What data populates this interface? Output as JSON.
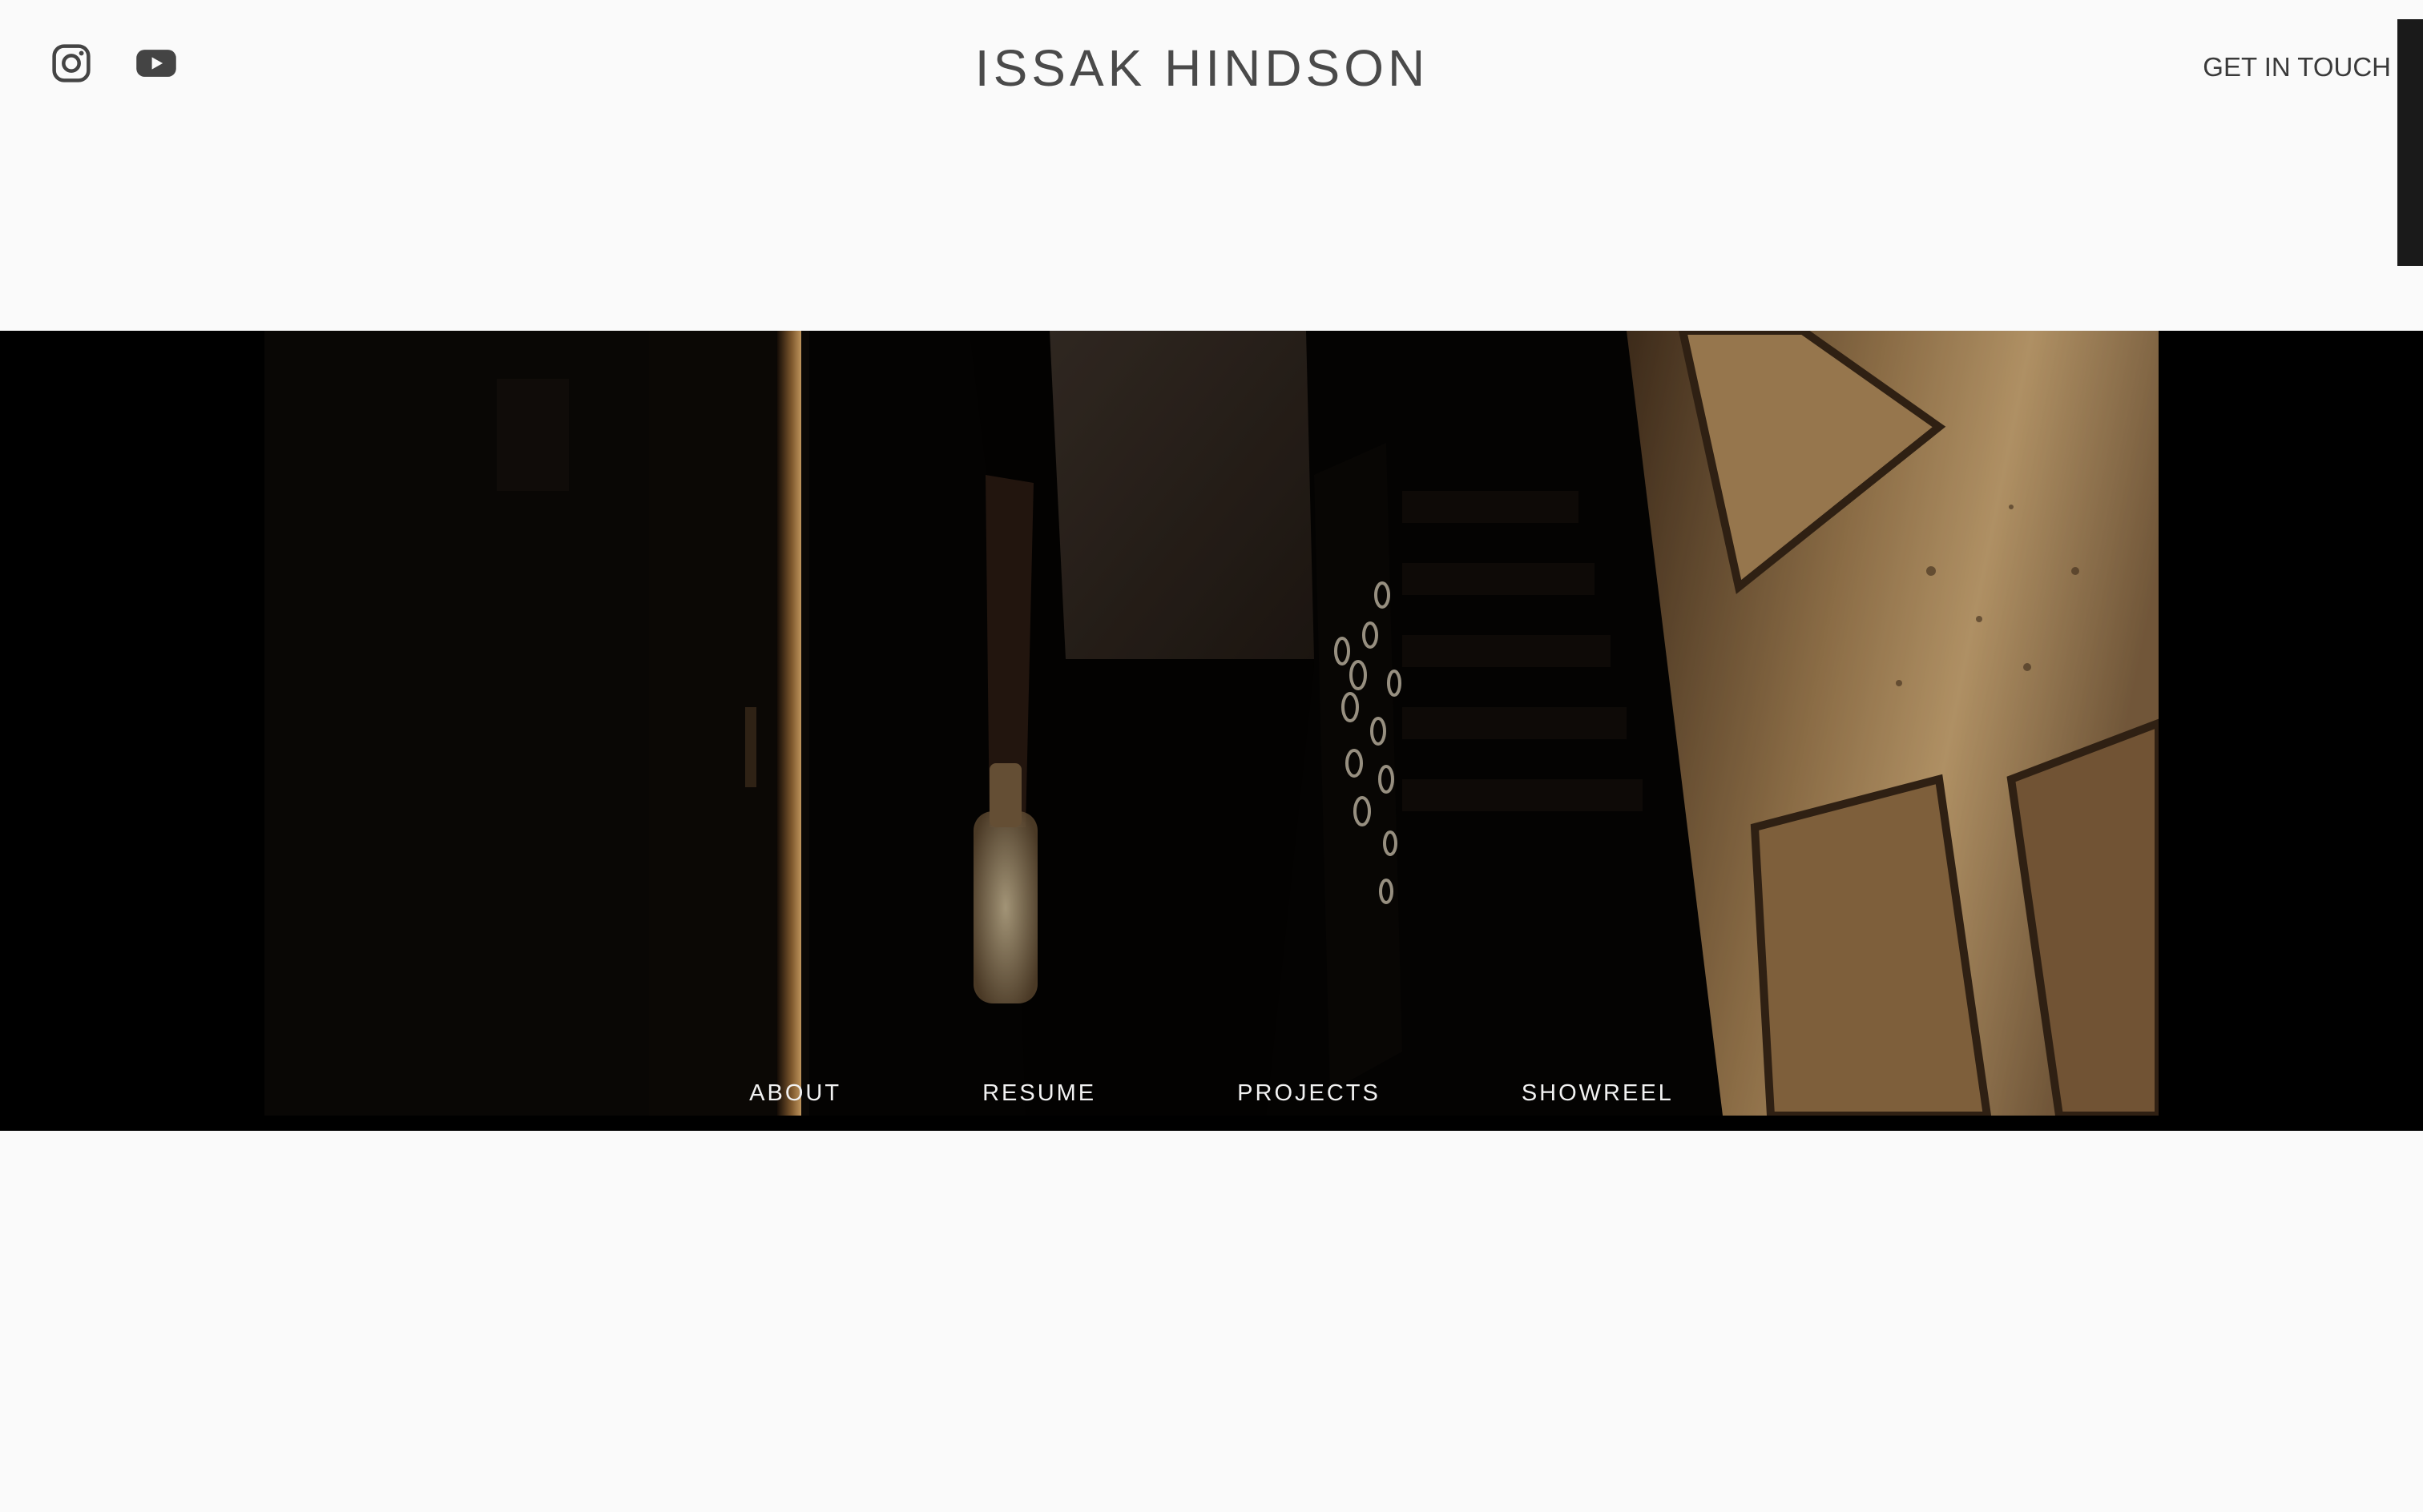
{
  "header": {
    "title": "ISSAK HINDSON",
    "contact_label": "GET IN TOUCH",
    "social": [
      {
        "icon": "instagram-icon"
      },
      {
        "icon": "youtube-icon"
      }
    ]
  },
  "hero": {
    "image": "film-still-icon"
  },
  "nav": {
    "items": [
      {
        "label": "ABOUT"
      },
      {
        "label": "RESUME"
      },
      {
        "label": "PROJECTS"
      },
      {
        "label": "SHOWREEL"
      }
    ]
  },
  "colors": {
    "background": "#fafafa",
    "title_text": "#4a4a4a",
    "nav_text": "#f2f2f2",
    "hero_bg": "#000000"
  }
}
